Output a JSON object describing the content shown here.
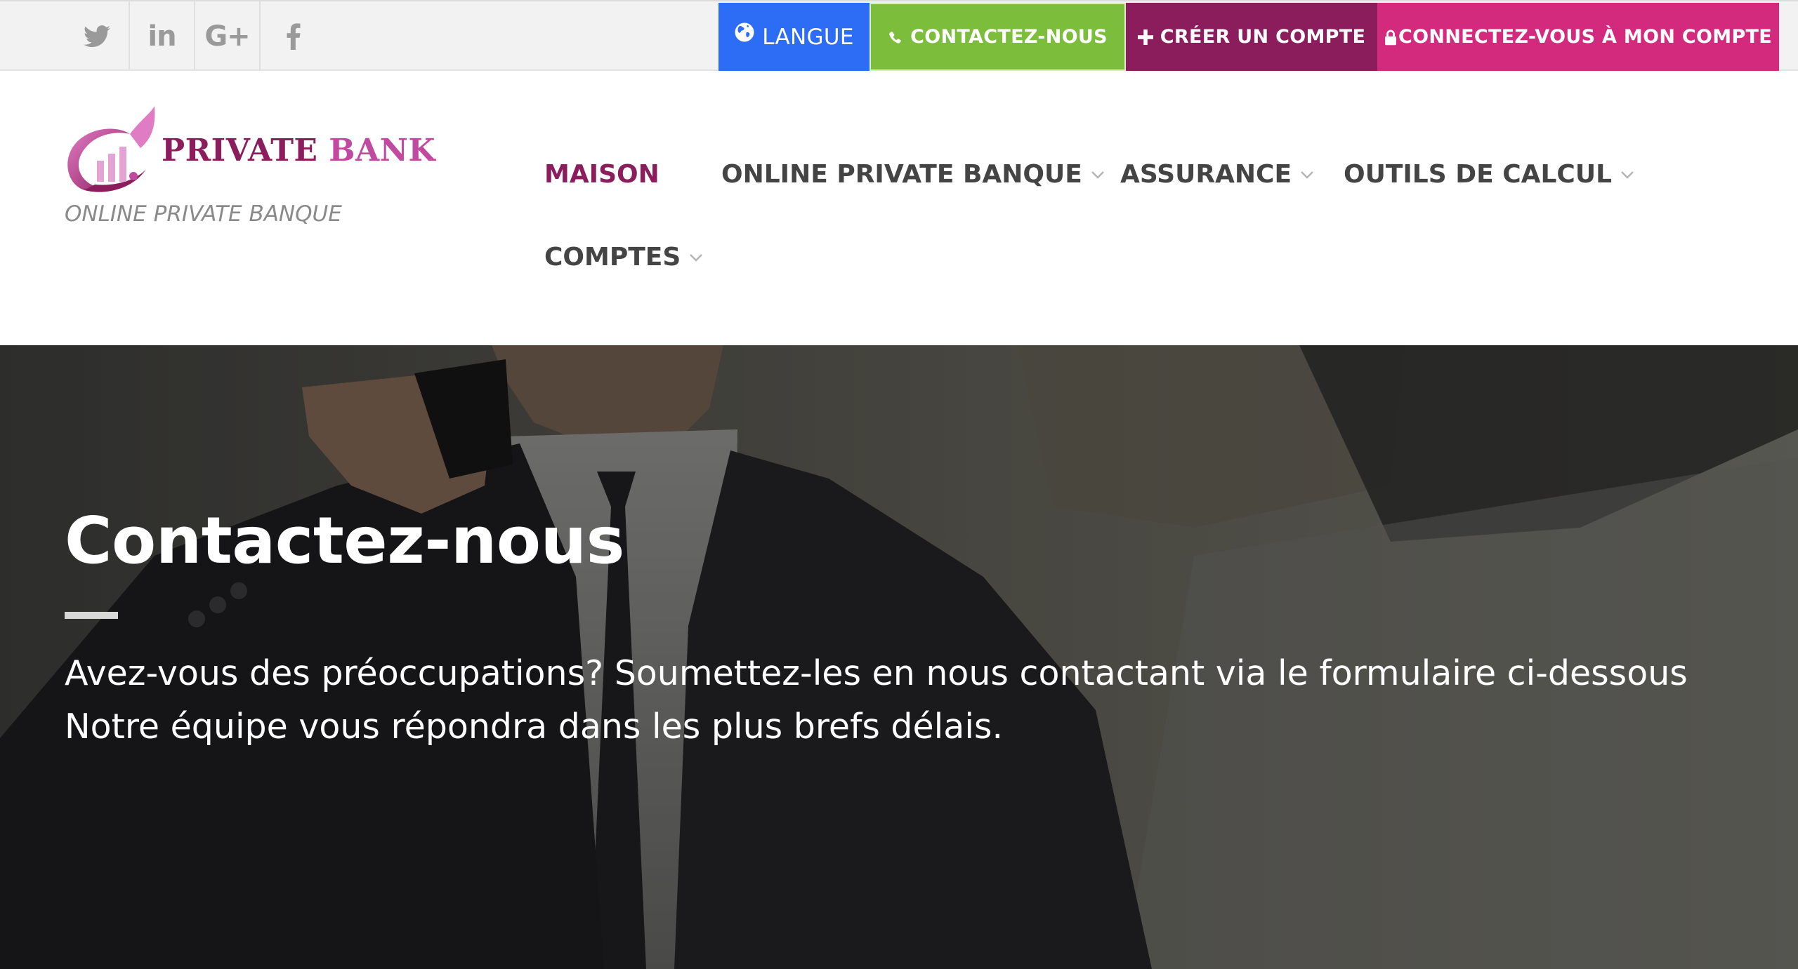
{
  "colors": {
    "langue": "#2d6df6",
    "contact": "#7cbd3c",
    "create": "#8b1d5c",
    "login": "#d42a7e",
    "nav_active": "#8b1d5c",
    "nav": "#444444"
  },
  "topbar": {
    "socials": [
      {
        "name": "twitter-icon"
      },
      {
        "name": "linkedin-icon",
        "text": "in"
      },
      {
        "name": "google-plus-icon",
        "text": "G+"
      },
      {
        "name": "facebook-icon"
      }
    ],
    "langue_label": "LANGUE",
    "contact_label": "CONTACTEZ-NOUS",
    "create_label": "CRÉER UN COMPTE",
    "login_label": "CONNECTEZ-VOUS À MON COMPTE"
  },
  "header": {
    "logo": {
      "word1": "PRIVATE",
      "word2": "BANK"
    },
    "tagline": "ONLINE PRIVATE BANQUE",
    "nav": [
      {
        "label": "MAISON",
        "active": true
      },
      {
        "label": "ONLINE PRIVATE BANQUE",
        "dropdown": true
      },
      {
        "label": "ASSURANCE",
        "dropdown": true
      },
      {
        "label": "OUTILS DE CALCUL",
        "dropdown": true
      },
      {
        "label": "COMPTES",
        "dropdown": true
      }
    ]
  },
  "hero": {
    "title": "Contactez-nous",
    "line1": "Avez-vous des préoccupations? Soumettez-les en nous contactant via le formulaire ci-dessous",
    "line2": "Notre équipe vous répondra dans les plus brefs délais."
  }
}
